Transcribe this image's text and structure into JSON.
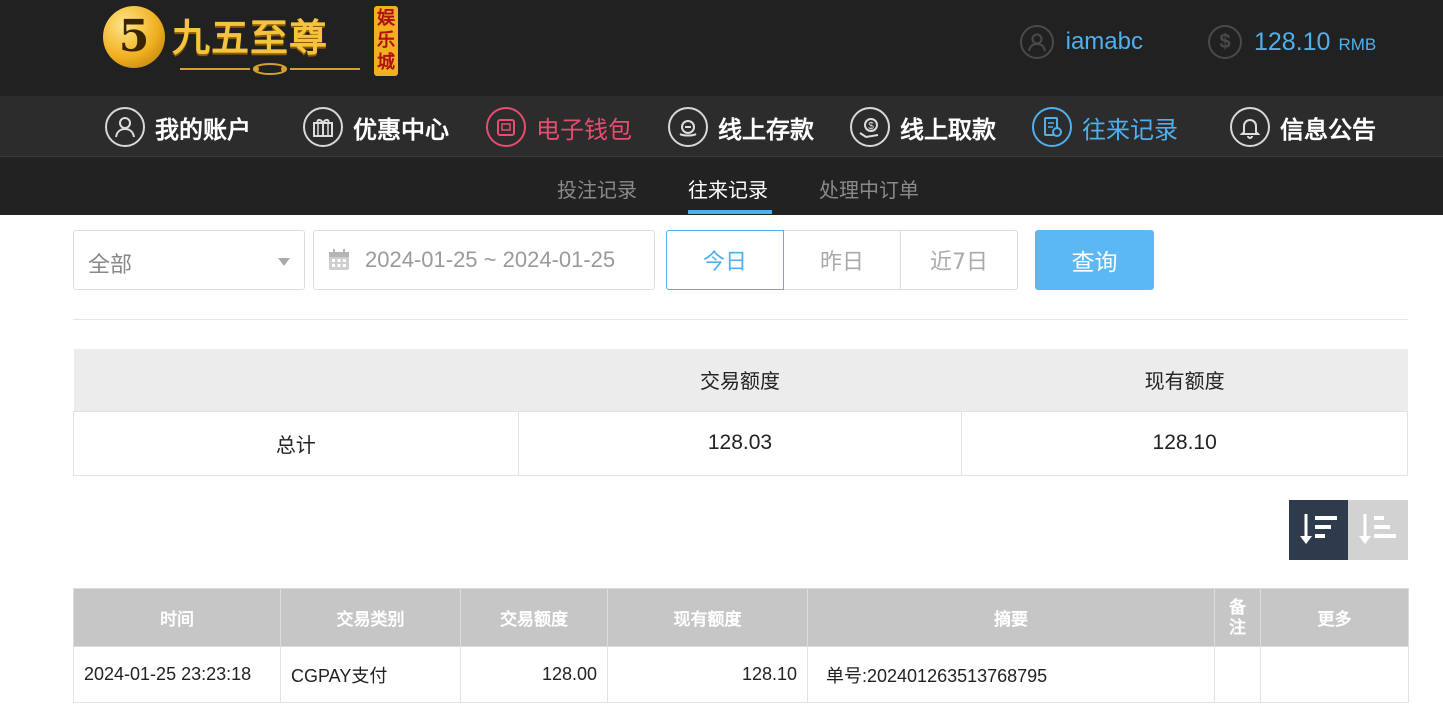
{
  "brand": {
    "badge": "5",
    "name": "九五至尊",
    "tag": "娱乐城"
  },
  "user": {
    "username": "iamabc",
    "balance": "128.10",
    "currency": "RMB"
  },
  "main_nav": [
    {
      "label": "我的账户",
      "icon": "user-icon"
    },
    {
      "label": "优惠中心",
      "icon": "gift-icon"
    },
    {
      "label": "电子钱包",
      "icon": "wallet-icon",
      "color": "#e84c6e"
    },
    {
      "label": "线上存款",
      "icon": "deposit-icon"
    },
    {
      "label": "线上取款",
      "icon": "withdraw-icon"
    },
    {
      "label": "往来记录",
      "icon": "records-icon",
      "color": "#4fb0ee",
      "active": true
    },
    {
      "label": "信息公告",
      "icon": "bell-icon"
    }
  ],
  "sub_nav": [
    {
      "label": "投注记录"
    },
    {
      "label": "往来记录",
      "active": true
    },
    {
      "label": "处理中订单"
    }
  ],
  "filters": {
    "type_selected": "全部",
    "date_range": "2024-01-25 ~ 2024-01-25",
    "quick_days": [
      "今日",
      "昨日",
      "近7日"
    ],
    "active_day": "今日",
    "query_label": "查询"
  },
  "summary": {
    "headers": [
      "",
      "交易额度",
      "现有额度"
    ],
    "row_label": "总计",
    "trade_amount": "128.03",
    "current_amount": "128.10"
  },
  "records": {
    "headers": [
      "时间",
      "交易类别",
      "交易额度",
      "现有额度",
      "摘要",
      "备注",
      "更多"
    ],
    "rows": [
      {
        "time": "2024-01-25 23:23:18",
        "type": "CGPAY支付",
        "trade_amount": "128.00",
        "current_amount": "128.10",
        "summary": "单号:202401263513768795",
        "note": "",
        "more": ""
      }
    ]
  },
  "colors": {
    "accent_blue": "#4fb0ee",
    "accent_pink": "#e84c6e",
    "header_bg": "#212121",
    "nav_bg": "#2c2c2c",
    "query_bg": "#5cb8f5"
  }
}
